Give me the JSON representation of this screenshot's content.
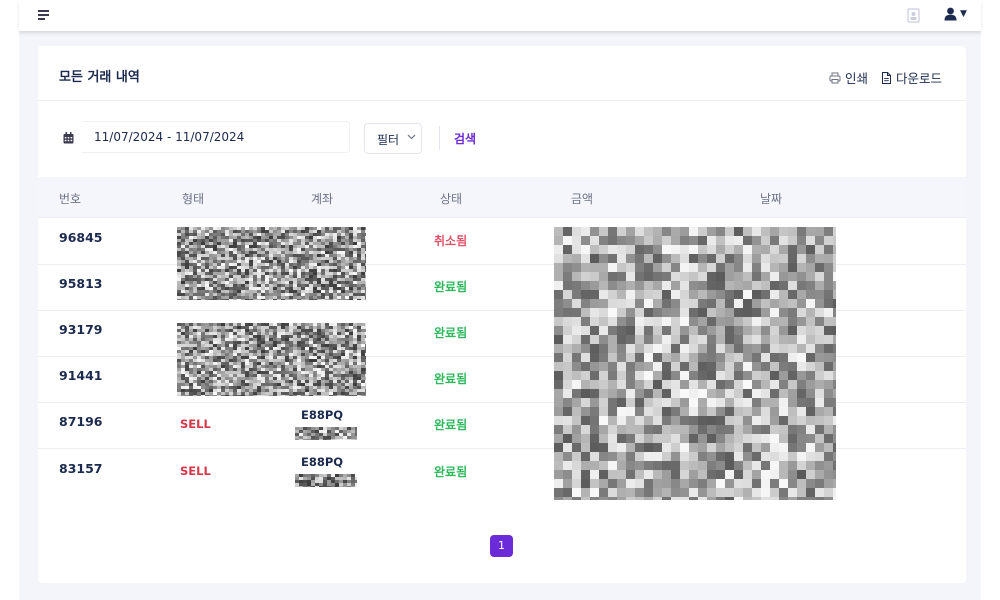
{
  "topbar": {
    "menu_icon": "hamburger-menu-icon",
    "doc_icon": "document-user-icon",
    "user_icon": "user-icon",
    "caret_icon": "caret-down-icon"
  },
  "card": {
    "title": "모든 거래 내역",
    "print_label": "인쇄",
    "download_label": "다운로드"
  },
  "filters": {
    "date_range": "11/07/2024 - 11/07/2024",
    "filter_label": "필터",
    "search_label": "검색"
  },
  "table": {
    "headers": [
      "번호",
      "형태",
      "계좌",
      "상태",
      "금액",
      "날짜"
    ],
    "rows": [
      {
        "id": "96845",
        "type": "",
        "account": "",
        "status": "취소됨"
      },
      {
        "id": "95813",
        "type": "",
        "account": "",
        "status": "완료됨"
      },
      {
        "id": "93179",
        "type": "",
        "account": "",
        "status": "완료됨"
      },
      {
        "id": "91441",
        "type": "",
        "account": "",
        "status": "완료됨"
      },
      {
        "id": "87196",
        "type": "SELL",
        "account": "E88PQ",
        "status": "완료됨"
      },
      {
        "id": "83157",
        "type": "SELL",
        "account": "E88PQ",
        "status": "완료됨"
      }
    ]
  },
  "pagination": {
    "current_page": "1"
  },
  "colors": {
    "accent": "#6c2bd9",
    "success": "#2eb85c",
    "danger": "#d43a4a",
    "cancelled": "#e0546a",
    "text": "#1b2a4e"
  }
}
